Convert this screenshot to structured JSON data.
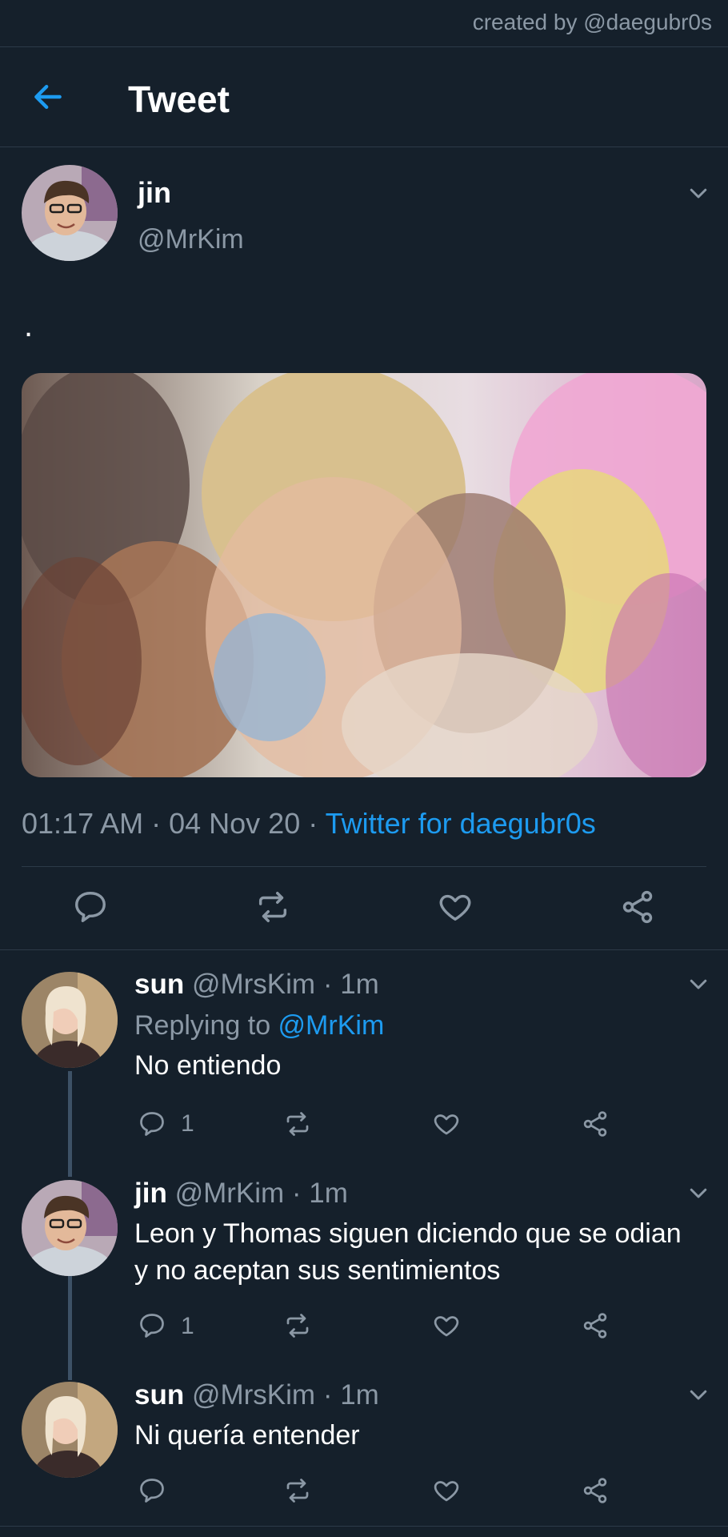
{
  "credit": "created by @daegubr0s",
  "header": {
    "title": "Tweet",
    "back_icon": "arrow-left-icon"
  },
  "tweet": {
    "author_name": "jin",
    "author_handle": "@MrKim",
    "text": ".",
    "time": "01:17 AM",
    "date": "04 Nov 20",
    "separator": " · ",
    "source": "Twitter for daegubr0s",
    "actions": [
      "reply-icon",
      "retweet-icon",
      "like-icon",
      "share-icon"
    ]
  },
  "replies": [
    {
      "name": "sun",
      "handle": "@MrsKim",
      "time": "1m",
      "dot": " · ",
      "replying_prefix": "Replying to ",
      "replying_to": "@MrKim",
      "text": "No entiendo",
      "reply_count": "1"
    },
    {
      "name": "jin",
      "handle": "@MrKim",
      "time": "1m",
      "dot": " · ",
      "text": "Leon y Thomas siguen diciendo que se odian y no aceptan sus sentimientos",
      "reply_count": "1"
    },
    {
      "name": "sun",
      "handle": "@MrsKim",
      "time": "1m",
      "dot": " · ",
      "text": "Ni quería entender"
    }
  ],
  "colors": {
    "background": "#15202b",
    "accent": "#1d9bf0",
    "secondary_text": "#8b98a5",
    "divider": "#2c3a48"
  }
}
